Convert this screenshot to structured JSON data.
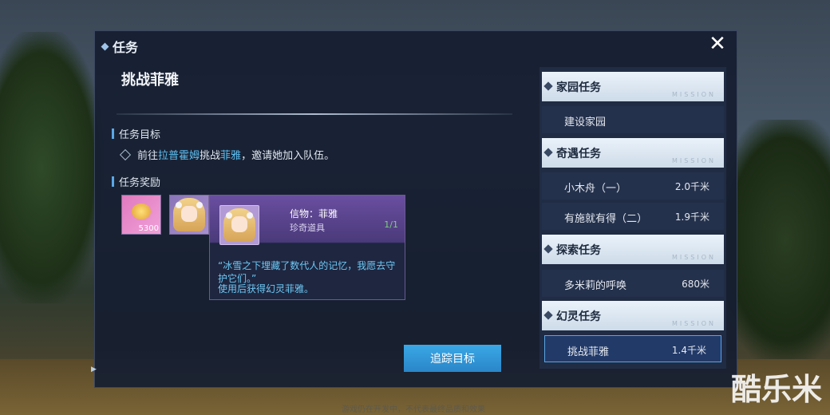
{
  "window": {
    "title": "任务",
    "close_label": "✕"
  },
  "task": {
    "title": "挑战菲雅",
    "goal_header": "任务目标",
    "goal": {
      "part1": "前往",
      "place": "拉普霍姆",
      "part2": "挑战",
      "target": "菲雅",
      "part3": "，邀请她加入队伍。"
    },
    "reward_header": "任务奖励",
    "rewards": [
      {
        "icon": "gold-coin-icon",
        "qty": "5300"
      },
      {
        "icon": "character-token-icon"
      }
    ]
  },
  "tooltip": {
    "name": "信物：菲雅",
    "rarity": "珍奇道具",
    "count": "1/1",
    "description": "“冰雪之下埋藏了数代人的记忆，我愿去守护它们。”",
    "usage": "使用后获得幻灵菲雅。"
  },
  "track_button": "追踪目标",
  "mission_list": [
    {
      "category": "家园任务",
      "watermark": "MISSION",
      "items": [
        {
          "name": "建设家园",
          "distance": ""
        }
      ]
    },
    {
      "category": "奇遇任务",
      "watermark": "MISSION",
      "items": [
        {
          "name": "小木舟（一）",
          "distance": "2.0千米"
        },
        {
          "name": "有施就有得（二）",
          "distance": "1.9千米"
        }
      ]
    },
    {
      "category": "探索任务",
      "watermark": "MISSION",
      "items": [
        {
          "name": "多米莉的呼唤",
          "distance": "680米"
        }
      ]
    },
    {
      "category": "幻灵任务",
      "watermark": "MISSION",
      "items": [
        {
          "name": "挑战菲雅",
          "distance": "1.4千米",
          "active": true
        }
      ]
    }
  ],
  "footer_note": "游戏仍在开发中，不代表最终品质和效果",
  "watermark": "酷乐米",
  "colors": {
    "accent": "#3aa8e6",
    "highlight_text": "#5ec0f2",
    "tooltip_purple": "#6a4ea0"
  }
}
